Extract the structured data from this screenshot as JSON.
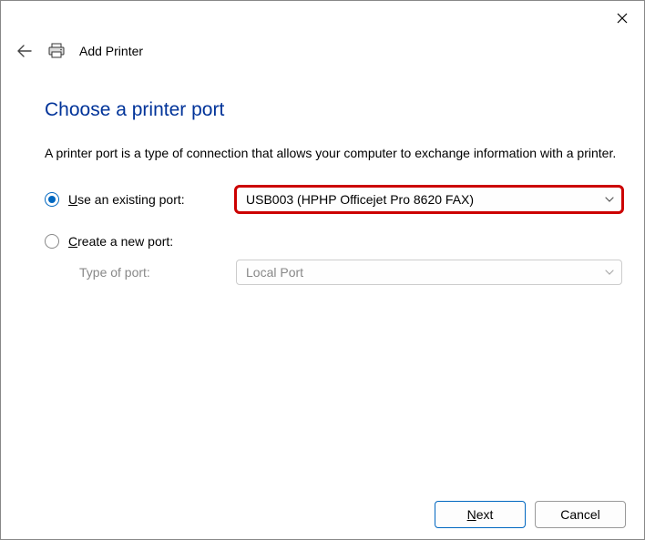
{
  "window": {
    "title": "Add Printer"
  },
  "page": {
    "heading": "Choose a printer port",
    "description": "A printer port is a type of connection that allows your computer to exchange information with a printer."
  },
  "options": {
    "existing": {
      "label_prefix": "U",
      "label_rest": "se an existing port:",
      "selected_value": "USB003 (HPHP Officejet Pro 8620 FAX)"
    },
    "create": {
      "label_prefix": "C",
      "label_rest": "reate a new port:",
      "type_of_port_label": "Type of port:",
      "type_of_port_value": "Local Port"
    }
  },
  "footer": {
    "next_prefix": "N",
    "next_rest": "ext",
    "cancel": "Cancel"
  }
}
